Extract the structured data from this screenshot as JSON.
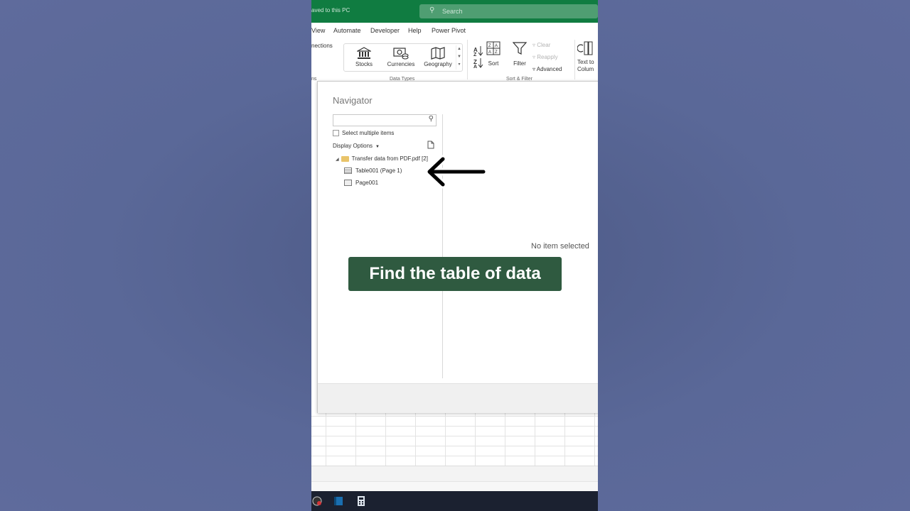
{
  "titlebar": {
    "saved_text": "aved to this PC",
    "search_placeholder": "Search"
  },
  "menu": {
    "items": [
      "View",
      "Automate",
      "Developer",
      "Help",
      "Power Pivot"
    ]
  },
  "ribbon": {
    "connections_label": "nections",
    "ms_label": "ns",
    "data_types": [
      "Stocks",
      "Currencies",
      "Geography"
    ],
    "data_types_group_label": "Data Types",
    "sort_label": "Sort",
    "filter_label": "Filter",
    "clear_label": "Clear",
    "reapply_label": "Reapply",
    "advanced_label": "Advanced",
    "sort_filter_group_label": "Sort & Filter",
    "text_to_columns_label_1": "Text to",
    "text_to_columns_label_2": "Colum"
  },
  "navigator": {
    "title": "Navigator",
    "search_value": "",
    "select_multiple_label": "Select multiple items",
    "display_options_label": "Display Options",
    "folder_label": "Transfer data from PDF.pdf [2]",
    "items": [
      "Table001 (Page 1)",
      "Page001"
    ],
    "no_item_text": "No item selected"
  },
  "caption": "Find the table of data",
  "colors": {
    "excel_green": "#107c41",
    "caption_bg": "#2f5a40",
    "background": "#5a6898"
  }
}
